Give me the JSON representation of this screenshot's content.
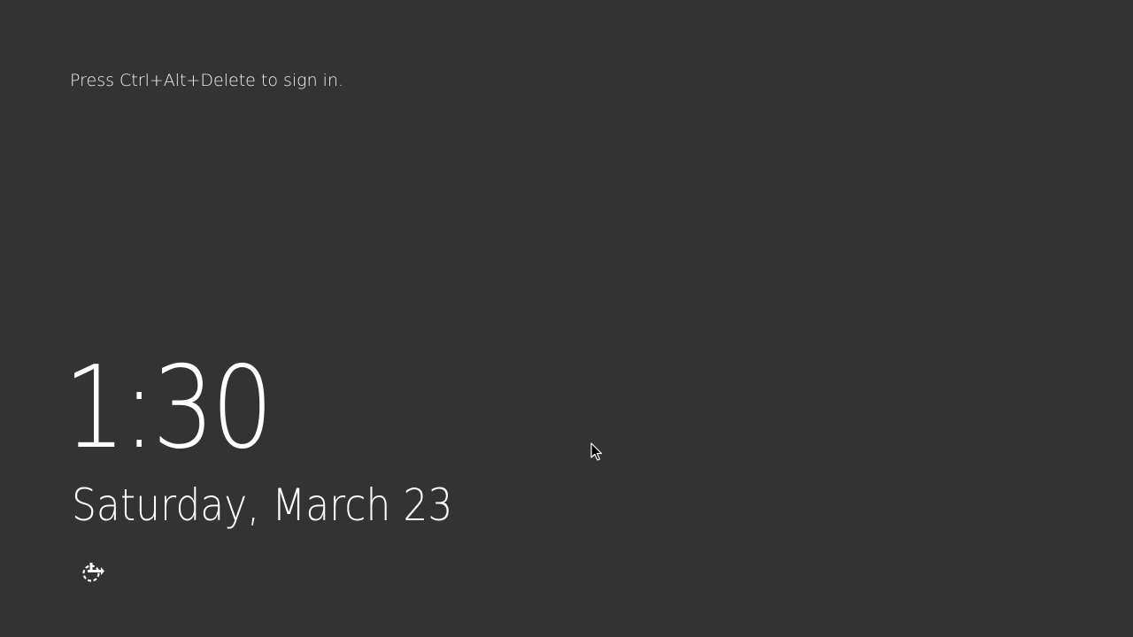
{
  "lock_screen": {
    "prompt_text": "Press Ctrl+Alt+Delete to sign in.",
    "time": "1:30",
    "date": "Saturday, March 23"
  },
  "icons": {
    "status_icon": "network-status-icon",
    "pointer": "mouse-cursor-icon"
  },
  "colors": {
    "background": "#333333",
    "text": "#ffffff"
  }
}
